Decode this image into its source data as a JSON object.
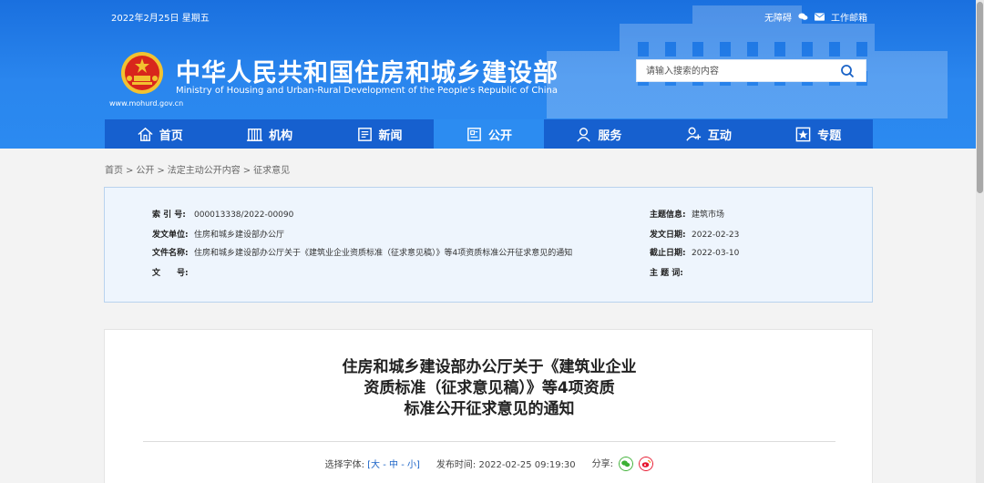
{
  "topbar": {
    "date": "2022年2月25日 星期五",
    "accessibility": "无障碍",
    "mail": "工作邮箱"
  },
  "site": {
    "title": "中华人民共和国住房和城乡建设部",
    "subtitle": "Ministry of Housing and Urban-Rural Development of the People's Republic of China",
    "url": "www.mohurd.gov.cn"
  },
  "search": {
    "placeholder": "请输入搜索的内容"
  },
  "nav": [
    {
      "label": "首页",
      "icon": "home-icon"
    },
    {
      "label": "机构",
      "icon": "building-icon"
    },
    {
      "label": "新闻",
      "icon": "news-icon"
    },
    {
      "label": "公开",
      "icon": "document-icon"
    },
    {
      "label": "服务",
      "icon": "service-icon"
    },
    {
      "label": "互动",
      "icon": "interact-icon"
    },
    {
      "label": "专题",
      "icon": "topic-icon"
    }
  ],
  "breadcrumb": [
    "首页",
    "公开",
    "法定主动公开内容",
    "征求意见"
  ],
  "info": {
    "index_label": "索 引 号:",
    "index_value": "000013338/2022-00090",
    "issuer_label": "发文单位:",
    "issuer_value": "住房和城乡建设部办公厅",
    "filename_label": "文件名称:",
    "filename_value": "住房和城乡建设部办公厅关于《建筑业企业资质标准（征求意见稿）》等4项资质标准公开征求意见的通知",
    "docno_label": "文　　号:",
    "docno_value": "",
    "topic_label": "主题信息:",
    "topic_value": "建筑市场",
    "date_label": "发文日期:",
    "date_value": "2022-02-23",
    "deadline_label": "截止日期:",
    "deadline_value": "2022-03-10",
    "keywords_label": "主 题 词:",
    "keywords_value": ""
  },
  "article": {
    "title_lines": [
      "住房和城乡建设部办公厅关于《建筑业企业",
      "资质标准（征求意见稿）》等4项资质",
      "标准公开征求意见的通知"
    ],
    "font_label": "选择字体:",
    "font_open": "[",
    "font_large": "大",
    "font_mid": "中",
    "font_small": "小",
    "font_close": "]",
    "font_sep": " - ",
    "publish_label": "发布时间:",
    "publish_time": "2022-02-25 09:19:30",
    "share_label": "分享:"
  },
  "colors": {
    "header": "#1a70df",
    "nav": "#1660cf",
    "nav_active": "#2c8cf1",
    "info_bg": "#eef5fd",
    "link": "#1a63c7"
  }
}
